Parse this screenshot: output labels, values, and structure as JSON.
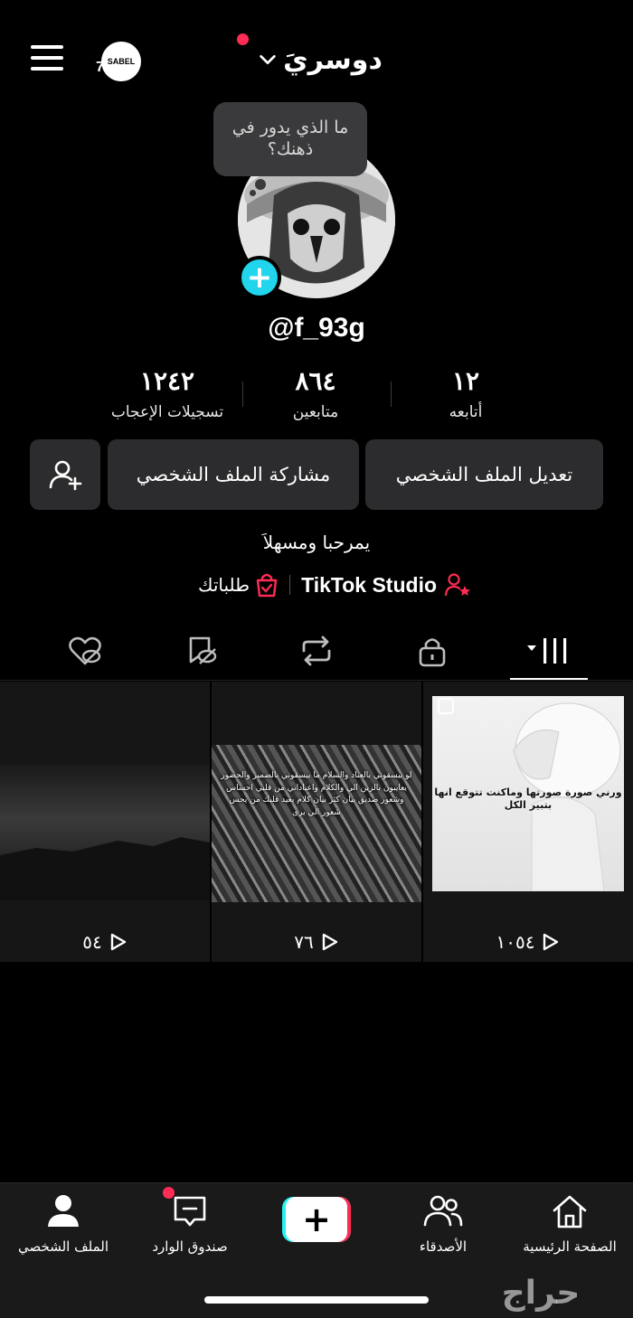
{
  "header": {
    "title": "دوسريَ",
    "badge_number": "7",
    "badge_text": "SABEL"
  },
  "profile": {
    "bubble_text": "ما الذي يدور في ذهنك؟",
    "handle": "@f_93g",
    "bio": "يمرحبا ومسهلاَ",
    "studio_label": "TikTok Studio",
    "orders_label": "طلباتك"
  },
  "stats": {
    "following": {
      "value": "١٢",
      "label": "أتابعه"
    },
    "followers": {
      "value": "٨٦٤",
      "label": "متابعين"
    },
    "likes": {
      "value": "١٢٤٢",
      "label": "تسجيلات الإعجاب"
    }
  },
  "buttons": {
    "edit_profile": "تعديل الملف الشخصي",
    "share_profile": "مشاركة الملف الشخصي"
  },
  "videos": [
    {
      "views": "١٠٥٤",
      "caption": "ورني صورة صورتها وماكنت تتوقع انها بتبير الكل"
    },
    {
      "views": "٧٦",
      "caption": "لو بيسقوني بالعناد والسلام ما بيسقوني بالضمير والحضور يعايبون بالزين الي والكلام واعياداني من قلبي احساس وشعور صديق بيان كثر بيان كلام بعيد قلبك من يحس شعور الي يرى"
    },
    {
      "views": "٥٤",
      "caption": ""
    }
  ],
  "nav": {
    "home": "الصفحة الرئيسية",
    "friends": "الأصدقاء",
    "inbox": "صندوق الوارد",
    "profile": "الملف الشخصي"
  },
  "watermark": "حراج",
  "colors": {
    "accent_red": "#ff2d55",
    "accent_cyan": "#20d5ec",
    "button_bg": "#2c2c2e"
  }
}
